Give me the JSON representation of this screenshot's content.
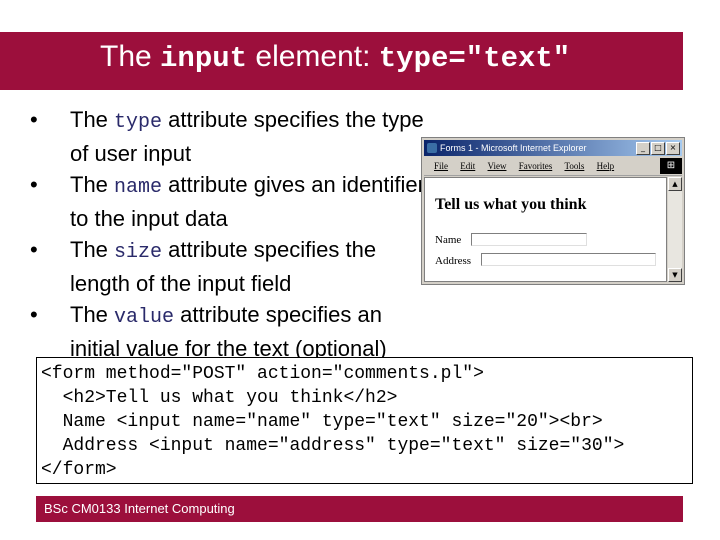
{
  "slide": {
    "title_prefix": "The ",
    "title_code1": "input",
    "title_mid": " element: ",
    "title_code2": "type=\"text\"",
    "bullets": [
      {
        "before": "The ",
        "code": "type",
        "after": " attribute specifies the type of user input"
      },
      {
        "before": "The ",
        "code": "name",
        "after": " attribute gives an identifier to the input data"
      },
      {
        "before": "The ",
        "code": "size",
        "after": " attribute specifies the length of the input field"
      },
      {
        "before": "The ",
        "code": "value",
        "after": " attribute specifies an initial value for the text (optional)"
      }
    ],
    "code_lines": [
      "<form method=\"POST\" action=\"comments.pl\">",
      "  <h2>Tell us what you think</h2>",
      "  Name <input name=\"name\" type=\"text\" size=\"20\"><br>",
      "  Address <input name=\"address\" type=\"text\" size=\"30\">",
      "</form>"
    ],
    "footer": "BSc CM0133 Internet Computing"
  },
  "browser": {
    "title": "Forms 1 - Microsoft Internet Explorer",
    "menu": [
      "File",
      "Edit",
      "View",
      "Favorites",
      "Tools",
      "Help"
    ],
    "heading": "Tell us what you think",
    "name_label": "Name",
    "address_label": "Address",
    "name_value": "",
    "address_value": ""
  },
  "colors": {
    "accent": "#9c0f3c",
    "code_text": "#2a2a6a"
  },
  "icons": {
    "bullet": "•",
    "minimize": "minimize-icon",
    "maximize": "maximize-icon",
    "close": "close-icon",
    "windows_logo": "windows-logo-icon"
  }
}
